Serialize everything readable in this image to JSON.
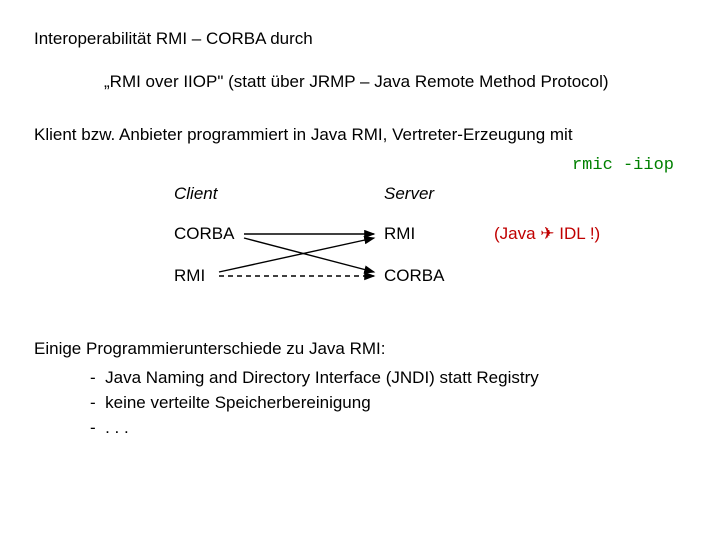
{
  "title_line": "Interoperabilität  RMI – CORBA durch",
  "quote_line": "„RMI over IIOP\"  (statt über JRMP – Java Remote Method Protocol)",
  "klient_line": "Klient bzw. Anbieter programmiert in Java RMI, Vertreter-Erzeugung mit",
  "rmic_cmd": "rmic -iiop",
  "diagram": {
    "client_header": "Client",
    "server_header": "Server",
    "left_corba": "CORBA",
    "left_rmi": "RMI",
    "right_rmi": "RMI",
    "right_corba": "CORBA",
    "note_prefix": "(Java ",
    "note_symbol": "✈",
    "note_suffix": " IDL !)"
  },
  "diff_heading": "Einige Programmierunterschiede zu Java RMI:",
  "bullets": [
    "Java Naming and Directory Interface (JNDI) statt Registry",
    "keine verteilte Speicherbereinigung",
    ". . ."
  ]
}
